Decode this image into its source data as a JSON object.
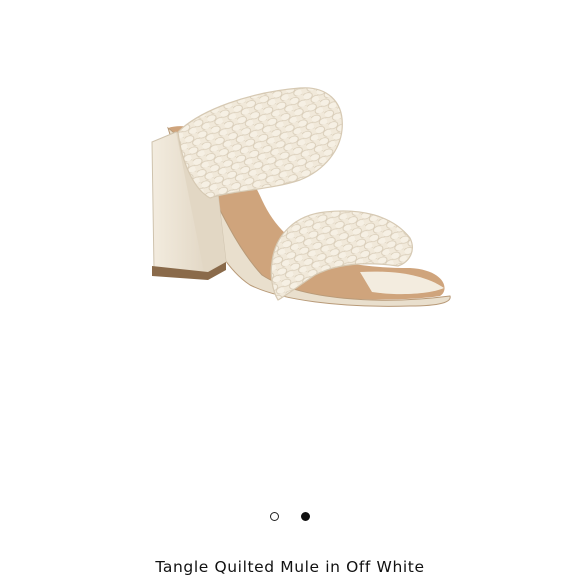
{
  "product": {
    "title": "Tangle Quilted Mule in Off White",
    "image_alt": "Tangle Quilted Mule"
  },
  "carousel": {
    "total_slides": 2,
    "active_index": 1
  },
  "colors": {
    "background": "#ffffff",
    "shoe": "#efe6d6",
    "heel_shadow": "#ddd2bf",
    "insole": "#c99c74",
    "sole_edge": "#8a6a4a"
  }
}
